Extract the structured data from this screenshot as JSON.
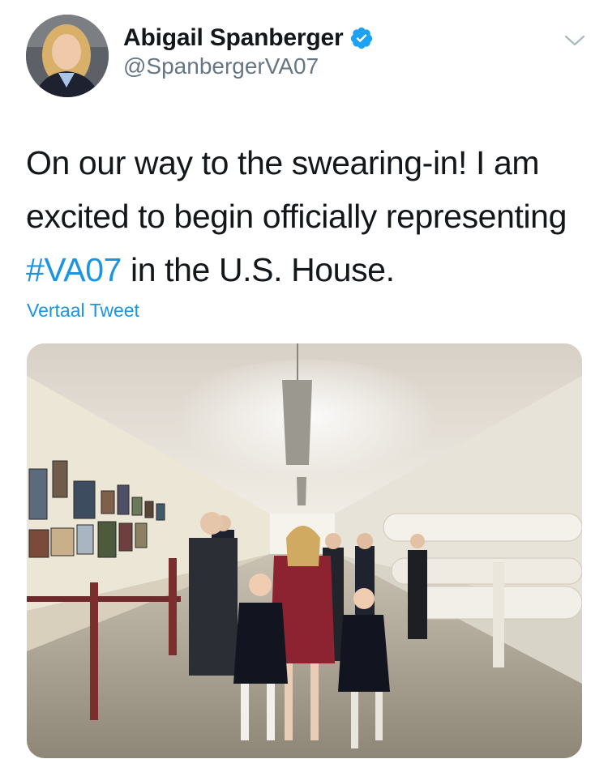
{
  "tweet": {
    "author": {
      "name": "Abigail Spanberger",
      "handle": "@SpanbergerVA07",
      "verified": true
    },
    "text": {
      "line1": "On our way to the swearing-in! I am",
      "line2": "excited to begin officially representing",
      "hashtag": "#VA07",
      "line3_rest": " in the U.S. House."
    },
    "translate_label": "Vertaal Tweet",
    "media": {
      "type": "photo"
    }
  },
  "colors": {
    "link": "#1b95e0",
    "text": "#14171a",
    "secondary": "#657786"
  },
  "icons": {
    "verified": "verified-badge-icon",
    "more": "chevron-down-icon"
  }
}
